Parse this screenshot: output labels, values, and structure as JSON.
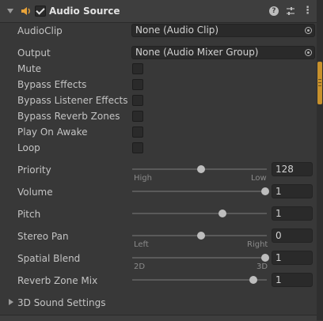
{
  "component": {
    "title": "Audio Source",
    "enabled": true,
    "icons": [
      "speaker-icon",
      "help-icon",
      "presets-icon",
      "more-menu-icon"
    ]
  },
  "fields": {
    "audio_clip": {
      "label": "AudioClip",
      "value": "None (Audio Clip)"
    },
    "output": {
      "label": "Output",
      "value": "None (Audio Mixer Group)"
    }
  },
  "toggles": [
    {
      "label": "Mute",
      "checked": false
    },
    {
      "label": "Bypass Effects",
      "checked": false
    },
    {
      "label": "Bypass Listener Effects",
      "checked": false
    },
    {
      "label": "Bypass Reverb Zones",
      "checked": false
    },
    {
      "label": "Play On Awake",
      "checked": false
    },
    {
      "label": "Loop",
      "checked": false
    }
  ],
  "sliders": {
    "priority": {
      "label": "Priority",
      "value": "128",
      "min_label": "High",
      "max_label": "Low"
    },
    "volume": {
      "label": "Volume",
      "value": "1"
    },
    "pitch": {
      "label": "Pitch",
      "value": "1"
    },
    "stereo_pan": {
      "label": "Stereo Pan",
      "value": "0",
      "min_label": "Left",
      "max_label": "Right"
    },
    "spatial_blend": {
      "label": "Spatial Blend",
      "value": "1",
      "min_label": "2D",
      "max_label": "3D"
    },
    "reverb_zone_mix": {
      "label": "Reverb Zone Mix",
      "value": "1"
    }
  },
  "foldouts": {
    "sound_3d": "3D Sound Settings"
  }
}
